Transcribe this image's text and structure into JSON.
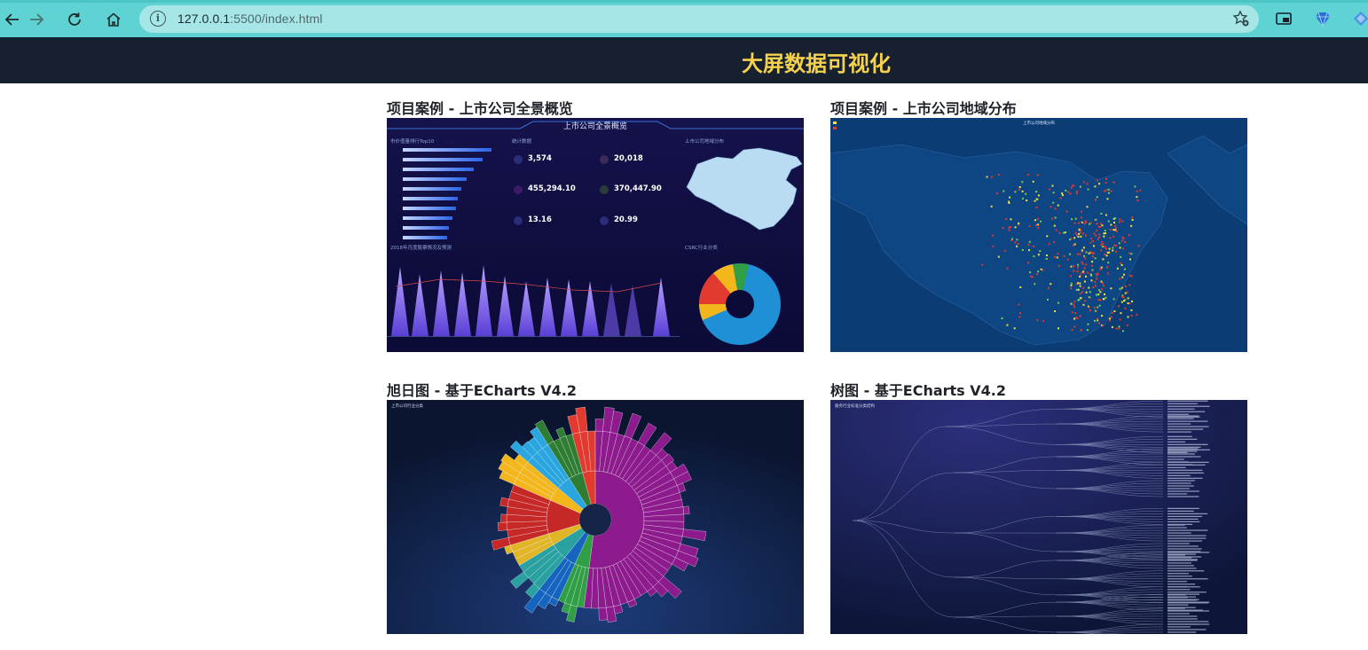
{
  "browser": {
    "url_host": "127.0.0.1",
    "url_path": ":5500/index.html"
  },
  "header": {
    "title": "大屏数据可视化"
  },
  "cards": [
    {
      "title": "项目案例 - 上市公司全景概览",
      "preview": {
        "heading": "上市公司全景概览",
        "panel_left_title": "市价值量排行Top10",
        "panel_mid_title": "统计数据",
        "panel_right_title": "上市公司地域分布",
        "panel_bottom_left_title": "2018年月度股票情况及预测",
        "panel_bottom_right_title": "CSRC行业分类",
        "stats": [
          {
            "value": "3,574"
          },
          {
            "value": "20,018"
          },
          {
            "value": "455,294.10"
          },
          {
            "value": "370,447.90"
          },
          {
            "value": "13.16"
          },
          {
            "value": "20.99"
          }
        ]
      }
    },
    {
      "title": "项目案例 - 上市公司地域分布",
      "preview": {
        "heading": "上市公司地域分布"
      }
    },
    {
      "title": "旭日图 - 基于ECharts V4.2",
      "preview": {
        "heading": "上市公司行业分类"
      }
    },
    {
      "title": "树图 - 基于ECharts V4.2",
      "preview": {
        "heading": "服务行业标准分类结构"
      }
    }
  ],
  "colors": {
    "header_bg": "#16202f",
    "title_gold": "#f5d14e",
    "browser_teal": "#5fd3d3"
  }
}
